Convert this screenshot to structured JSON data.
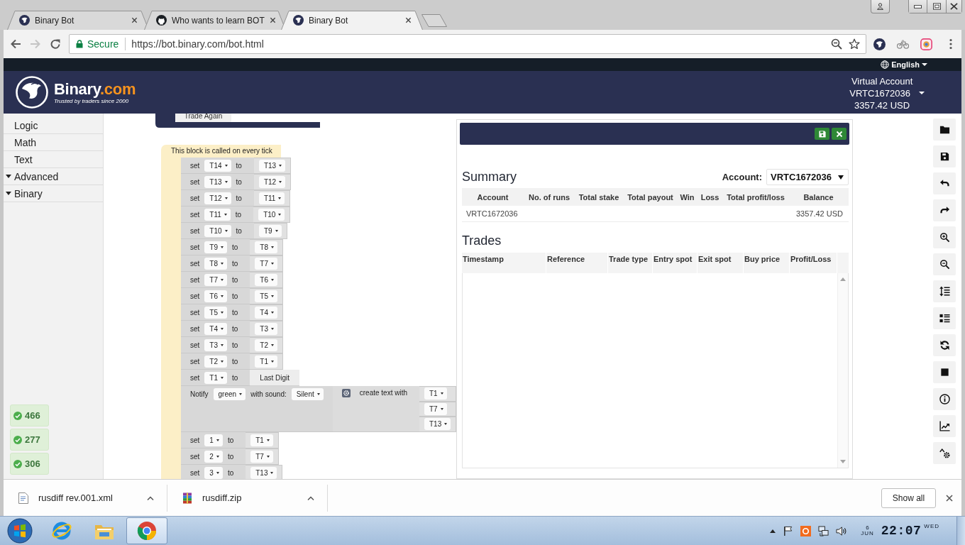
{
  "browser": {
    "tabs": [
      {
        "title": "Binary Bot",
        "kind": "site",
        "selected": false
      },
      {
        "title": "Who wants to learn BOT",
        "kind": "repo",
        "selected": false
      },
      {
        "title": "Binary Bot",
        "kind": "site",
        "selected": true
      }
    ],
    "nav": [
      {
        "kind": "back",
        "disabled": false
      },
      {
        "kind": "forward",
        "disabled": true
      },
      {
        "kind": "reload",
        "disabled": false
      }
    ],
    "address": {
      "security": "Secure",
      "url": "https://bot.binary.com/bot.html"
    }
  },
  "site": {
    "language": "English",
    "brand": "Binary",
    "brand_suffix": ".com",
    "tagline": "Trusted by traders since 2000",
    "account": {
      "type": "Virtual Account",
      "id": "VRTC1672036",
      "balance": "3357.42 USD"
    }
  },
  "toolbox": {
    "categories": [
      {
        "label": "Logic",
        "kind": "category"
      },
      {
        "label": "Math",
        "kind": "category"
      },
      {
        "label": "Text",
        "kind": "category"
      },
      {
        "label": "Advanced",
        "kind": "group"
      },
      {
        "label": "Binary",
        "kind": "group"
      }
    ]
  },
  "notifications": [
    {
      "count": "466"
    },
    {
      "count": "277"
    },
    {
      "count": "306"
    }
  ],
  "workspace": {
    "trade_block": {
      "button": "Trade Again"
    },
    "tick_block": {
      "title": "This block is called on every tick",
      "statements": [
        {
          "kind": "set",
          "keyword": "set",
          "variable": "T14",
          "connector": "to",
          "value": {
            "kind": "variable",
            "text": "T13"
          }
        },
        {
          "kind": "set",
          "keyword": "set",
          "variable": "T13",
          "connector": "to",
          "value": {
            "kind": "variable",
            "text": "T12"
          }
        },
        {
          "kind": "set",
          "keyword": "set",
          "variable": "T12",
          "connector": "to",
          "value": {
            "kind": "variable",
            "text": "T11"
          }
        },
        {
          "kind": "set",
          "keyword": "set",
          "variable": "T11",
          "connector": "to",
          "value": {
            "kind": "variable",
            "text": "T10"
          }
        },
        {
          "kind": "set",
          "keyword": "set",
          "variable": "T10",
          "connector": "to",
          "value": {
            "kind": "variable",
            "text": "T9"
          }
        },
        {
          "kind": "set",
          "keyword": "set",
          "variable": "T9",
          "connector": "to",
          "value": {
            "kind": "variable",
            "text": "T8"
          }
        },
        {
          "kind": "set",
          "keyword": "set",
          "variable": "T8",
          "connector": "to",
          "value": {
            "kind": "variable",
            "text": "T7"
          }
        },
        {
          "kind": "set",
          "keyword": "set",
          "variable": "T7",
          "connector": "to",
          "value": {
            "kind": "variable",
            "text": "T6"
          }
        },
        {
          "kind": "set",
          "keyword": "set",
          "variable": "T6",
          "connector": "to",
          "value": {
            "kind": "variable",
            "text": "T5"
          }
        },
        {
          "kind": "set",
          "keyword": "set",
          "variable": "T5",
          "connector": "to",
          "value": {
            "kind": "variable",
            "text": "T4"
          }
        },
        {
          "kind": "set",
          "keyword": "set",
          "variable": "T4",
          "connector": "to",
          "value": {
            "kind": "variable",
            "text": "T3"
          }
        },
        {
          "kind": "set",
          "keyword": "set",
          "variable": "T3",
          "connector": "to",
          "value": {
            "kind": "variable",
            "text": "T2"
          }
        },
        {
          "kind": "set",
          "keyword": "set",
          "variable": "T2",
          "connector": "to",
          "value": {
            "kind": "variable",
            "text": "T1"
          }
        },
        {
          "kind": "set",
          "keyword": "set",
          "variable": "T1",
          "connector": "to",
          "value": {
            "kind": "reading",
            "text": "Last Digit"
          }
        },
        {
          "kind": "notify",
          "keyword": "Notify",
          "notify_type": "green",
          "sound_label": "with sound:",
          "sound": "Silent",
          "text_label": "create text with",
          "items": [
            "T1",
            "T7",
            "T13"
          ]
        },
        {
          "kind": "set",
          "keyword": "set",
          "variable": "1",
          "connector": "to",
          "value": {
            "kind": "variable",
            "text": "T1"
          }
        },
        {
          "kind": "set",
          "keyword": "set",
          "variable": "2",
          "connector": "to",
          "value": {
            "kind": "variable",
            "text": "T7"
          }
        },
        {
          "kind": "set",
          "keyword": "set",
          "variable": "3",
          "connector": "to",
          "value": {
            "kind": "variable",
            "text": "T13"
          }
        }
      ]
    }
  },
  "summary_panel": {
    "summary": {
      "title": "Summary",
      "account_label": "Account:",
      "account": "VRTC1672036",
      "columns": [
        "Account",
        "No. of runs",
        "Total stake",
        "Total payout",
        "Win",
        "Loss",
        "Total profit/loss",
        "Balance"
      ],
      "rows": [
        {
          "account": "VRTC1672036",
          "balance": "3357.42 USD"
        }
      ]
    },
    "trades": {
      "title": "Trades",
      "columns": [
        "Timestamp",
        "Reference",
        "Trade type",
        "Entry spot",
        "Exit spot",
        "Buy price",
        "Profit/Loss"
      ]
    }
  },
  "downloads": {
    "items": [
      {
        "name": "rusdiff rev.001.xml",
        "kind": "xml"
      },
      {
        "name": "rusdiff.zip",
        "kind": "zip"
      }
    ],
    "show_all": "Show all"
  },
  "taskbar": {
    "apps": [
      {
        "kind": "ie",
        "selected": false
      },
      {
        "kind": "folder",
        "selected": false
      },
      {
        "kind": "chrome",
        "selected": true
      }
    ],
    "clock": {
      "day": "6",
      "month": "JUN",
      "time": "22:07",
      "weekday": "WED"
    }
  }
}
